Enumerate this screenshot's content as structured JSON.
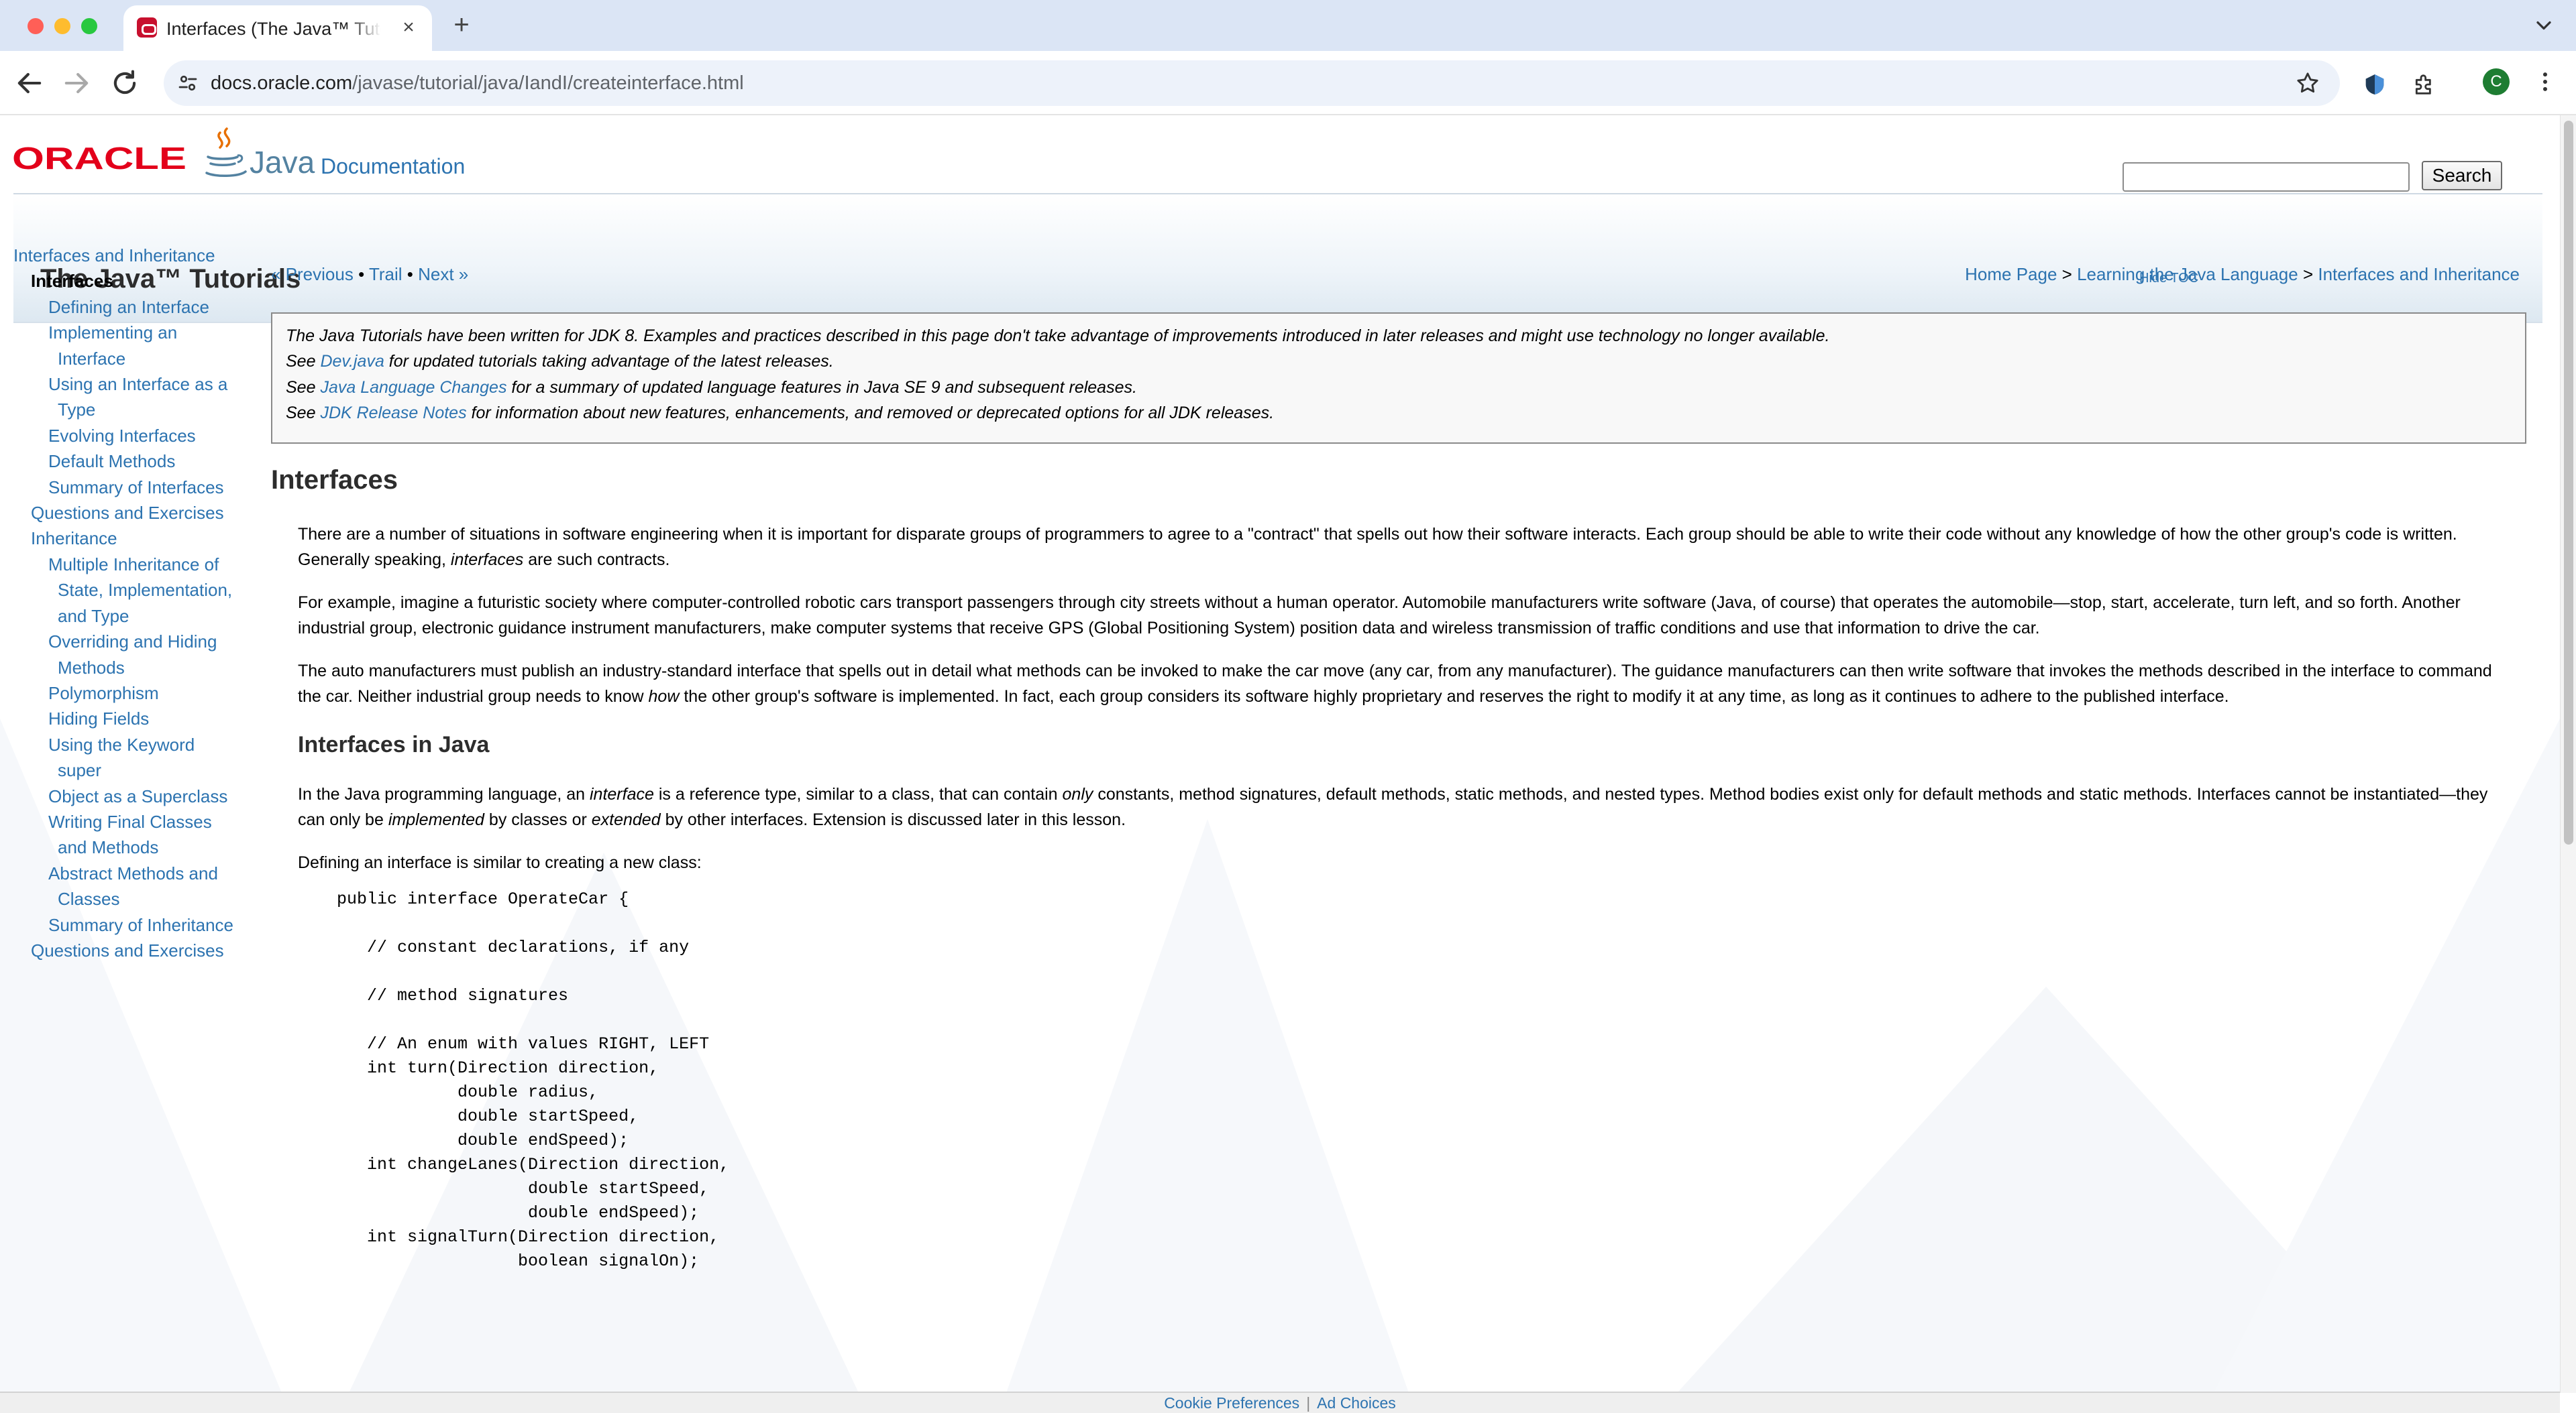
{
  "browser": {
    "tab_title": "Interfaces (The Java™ Tutorials",
    "url_domain": "docs.oracle.com",
    "url_path": "/javase/tutorial/java/IandI/createinterface.html",
    "avatar_letter": "C",
    "icons": {
      "back": "arrow-left-icon",
      "forward": "arrow-right-icon",
      "reload": "reload-icon",
      "site_info": "tune-icon",
      "bookmark": "star-icon",
      "extension1": "extension-shield-icon",
      "extensions": "puzzle-icon",
      "menu": "kebab-menu-icon"
    }
  },
  "header": {
    "oracle_logo": "ORACLE",
    "java_logo": "Java",
    "documentation": "Documentation",
    "title": "The Java™ Tutorials",
    "search_button": "Search",
    "hide_toc": "Hide TOC"
  },
  "toc": {
    "items": [
      {
        "label": "Interfaces and Inheritance",
        "level": 1
      },
      {
        "label": "Interfaces",
        "level": 2,
        "current": true
      },
      {
        "label": "Defining an Interface",
        "level": 3
      },
      {
        "label": "Implementing an",
        "level": 3
      },
      {
        "label": "Interface",
        "level": 3
      },
      {
        "label": "Using an Interface as a",
        "level": 3
      },
      {
        "label": "Type",
        "level": 3
      },
      {
        "label": "Evolving Interfaces",
        "level": 3
      },
      {
        "label": "Default Methods",
        "level": 3
      },
      {
        "label": "Summary of Interfaces",
        "level": 3
      },
      {
        "label": "Questions and Exercises",
        "level": 2
      },
      {
        "label": "Inheritance",
        "level": 2
      },
      {
        "label": "Multiple Inheritance of",
        "level": 3
      },
      {
        "label": "State, Implementation,",
        "level": 3
      },
      {
        "label": "and Type",
        "level": 3
      },
      {
        "label": "Overriding and Hiding",
        "level": 3
      },
      {
        "label": "Methods",
        "level": 3
      },
      {
        "label": "Polymorphism",
        "level": 3
      },
      {
        "label": "Hiding Fields",
        "level": 3
      },
      {
        "label": "Using the Keyword",
        "level": 3
      },
      {
        "label": "super",
        "level": 3
      },
      {
        "label": "Object as a Superclass",
        "level": 3
      },
      {
        "label": "Writing Final Classes",
        "level": 3
      },
      {
        "label": "and Methods",
        "level": 3
      },
      {
        "label": "Abstract Methods and",
        "level": 3
      },
      {
        "label": "Classes",
        "level": 3
      },
      {
        "label": "Summary of Inheritance",
        "level": 3
      },
      {
        "label": "Questions and Exercises",
        "level": 2
      }
    ]
  },
  "nav": {
    "previous": "« Previous",
    "trail": "Trail",
    "next": "Next »",
    "sep": "•",
    "crumbs": [
      "Home Page",
      "Learning the Java Language",
      "Interfaces and Inheritance"
    ],
    "crumb_sep": ">"
  },
  "notice": {
    "line1": "The Java Tutorials have been written for JDK 8. Examples and practices described in this page don't take advantage of improvements introduced in later releases and might use technology no longer available.",
    "line2_pre": "See ",
    "line2_link": "Dev.java",
    "line2_post": " for updated tutorials taking advantage of the latest releases.",
    "line3_pre": "See ",
    "line3_link": "Java Language Changes",
    "line3_post": " for a summary of updated language features in Java SE 9 and subsequent releases.",
    "line4_pre": "See ",
    "line4_link": "JDK Release Notes",
    "line4_post": " for information about new features, enhancements, and removed or deprecated options for all JDK releases."
  },
  "article": {
    "heading": "Interfaces",
    "p1_a": "There are a number of situations in software engineering when it is important for disparate groups of programmers to agree to a \"contract\" that spells out how their software interacts. Each group should be able to write their code without any knowledge of how the other group's code is written. Generally speaking, ",
    "p1_em": "interfaces",
    "p1_b": " are such contracts.",
    "p2": "For example, imagine a futuristic society where computer-controlled robotic cars transport passengers through city streets without a human operator. Automobile manufacturers write software (Java, of course) that operates the automobile—stop, start, accelerate, turn left, and so forth. Another industrial group, electronic guidance instrument manufacturers, make computer systems that receive GPS (Global Positioning System) position data and wireless transmission of traffic conditions and use that information to drive the car.",
    "p3_a": "The auto manufacturers must publish an industry-standard interface that spells out in detail what methods can be invoked to make the car move (any car, from any manufacturer). The guidance manufacturers can then write software that invokes the methods described in the interface to command the car. Neither industrial group needs to know ",
    "p3_em": "how",
    "p3_b": " the other group's software is implemented. In fact, each group considers its software highly proprietary and reserves the right to modify it at any time, as long as it continues to adhere to the published interface.",
    "subheading": "Interfaces in Java",
    "p4_a": "In the Java programming language, an ",
    "p4_em1": "interface",
    "p4_b": " is a reference type, similar to a class, that can contain ",
    "p4_em2": "only",
    "p4_c": " constants, method signatures, default methods, static methods, and nested types. Method bodies exist only for default methods and static methods. Interfaces cannot be instantiated—they can only be ",
    "p4_em3": "implemented",
    "p4_d": " by classes or ",
    "p4_em4": "extended",
    "p4_e": " by other interfaces. Extension is discussed later in this lesson.",
    "p5": "Defining an interface is similar to creating a new class:",
    "code": "public interface OperateCar {\n\n   // constant declarations, if any\n\n   // method signatures\n\n   // An enum with values RIGHT, LEFT\n   int turn(Direction direction,\n            double radius,\n            double startSpeed,\n            double endSpeed);\n   int changeLanes(Direction direction,\n                   double startSpeed,\n                   double endSpeed);\n   int signalTurn(Direction direction,\n                  boolean signalOn);"
  },
  "footer": {
    "cookie": "Cookie Preferences",
    "sep": "|",
    "ads": "Ad Choices"
  },
  "colors": {
    "link": "#2c73b0",
    "oracle_red": "#c8102e",
    "tabbar": "#dbe5f5"
  }
}
